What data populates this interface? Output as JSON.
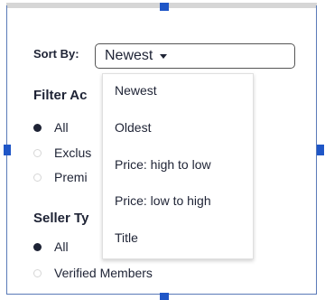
{
  "sort": {
    "label": "Sort By:",
    "selected": "Newest"
  },
  "dropdown": {
    "options": [
      "Newest",
      "Oldest",
      "Price: high to low",
      "Price: low to high",
      "Title"
    ]
  },
  "filter_access": {
    "title": "Filter Ac",
    "options": [
      {
        "label": "All",
        "checked": true
      },
      {
        "label": "Exclus",
        "checked": false
      },
      {
        "label": "Premi",
        "checked": false
      }
    ]
  },
  "seller_type": {
    "title": "Seller Ty",
    "options": [
      {
        "label": "All",
        "checked": true
      },
      {
        "label": "Verified Members",
        "checked": false
      }
    ]
  },
  "colors": {
    "handle": "#1f56c7",
    "text": "#1e2335"
  }
}
